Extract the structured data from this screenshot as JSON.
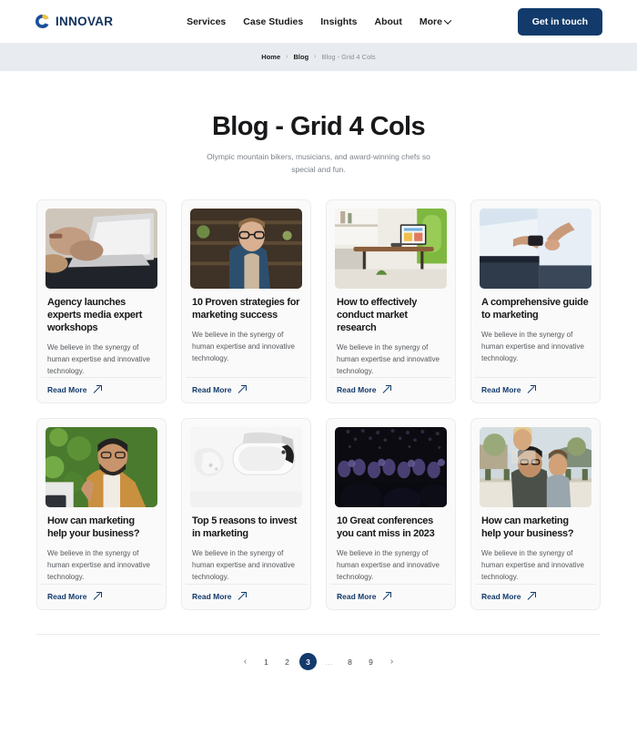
{
  "brand": {
    "name": "INNOVAR",
    "mark_icon": "innovar-swirl-logo",
    "colors": {
      "navy": "#123a6b",
      "yellow": "#f5c23c"
    }
  },
  "nav": {
    "items": [
      {
        "label": "Services",
        "has_chevron": false
      },
      {
        "label": "Case Studies",
        "has_chevron": false
      },
      {
        "label": "Insights",
        "has_chevron": false
      },
      {
        "label": "About",
        "has_chevron": false
      },
      {
        "label": "More",
        "has_chevron": true
      }
    ],
    "cta_label": "Get in touch"
  },
  "breadcrumb": {
    "separator": "›",
    "items": [
      {
        "label": "Home",
        "current": false
      },
      {
        "label": "Blog",
        "current": false
      },
      {
        "label": "Blog - Grid 4 Cols",
        "current": true
      }
    ]
  },
  "hero": {
    "title": "Blog - Grid 4 Cols",
    "subtitle": "Olympic mountain bikers, musicians, and award-winning chefs so special and fun."
  },
  "posts": [
    {
      "title": "Agency launches experts media expert workshops",
      "description": "We believe in the synergy of human expertise and innovative technology.",
      "read_more_label": "Read More",
      "image_alt": "hands-typing-on-laptop",
      "image_palette": [
        "#cfc6bb",
        "#b9aa9a",
        "#e2e0dd",
        "#7c7166"
      ]
    },
    {
      "title": "10 Proven strategies for marketing success",
      "description": "We believe in the synergy of human expertise and innovative technology.",
      "read_more_label": "Read More",
      "image_alt": "man-in-blue-blazer-with-glasses",
      "image_palette": [
        "#3f3226",
        "#2d4f6e",
        "#c8b39a",
        "#1d2a33"
      ]
    },
    {
      "title": "How to effectively conduct market research",
      "description": "We believe in the synergy of human expertise and innovative technology.",
      "read_more_label": "Read More",
      "image_alt": "tablet-on-wooden-desk-in-living-room",
      "image_palette": [
        "#efece6",
        "#8cc044",
        "#8a5f3a",
        "#d8d3ca"
      ]
    },
    {
      "title": "A comprehensive guide to marketing",
      "description": "We believe in the synergy of human expertise and innovative technology.",
      "read_more_label": "Read More",
      "image_alt": "handshake-exchanging-phone",
      "image_palette": [
        "#b8cde0",
        "#dfe9f2",
        "#2b3a4a",
        "#c99a7a"
      ]
    },
    {
      "title": "How can marketing help your business?",
      "description": "We believe in the synergy of human expertise and innovative technology.",
      "read_more_label": "Read More",
      "image_alt": "bearded-man-in-tan-jacket-outdoors",
      "image_palette": [
        "#4a7a2e",
        "#c9903f",
        "#2b2b2b",
        "#8fb85c"
      ]
    },
    {
      "title": "Top 5 reasons to invest in marketing",
      "description": "We believe in the synergy of human expertise and innovative technology.",
      "read_more_label": "Read More",
      "image_alt": "white-vr-headset",
      "image_palette": [
        "#f4f4f4",
        "#e2e2e2",
        "#cfcfcf",
        "#2a2a2a"
      ]
    },
    {
      "title": "10 Great conferences you cant miss in 2023",
      "description": "We believe in the synergy of human expertise and innovative technology.",
      "read_more_label": "Read More",
      "image_alt": "dark-conference-audience",
      "image_palette": [
        "#0c0c12",
        "#2a2340",
        "#4b3f6b",
        "#15131c"
      ]
    },
    {
      "title": "How can marketing help your business?",
      "description": "We believe in the synergy of human expertise and innovative technology.",
      "read_more_label": "Read More",
      "image_alt": "father-with-two-children-outdoors",
      "image_palette": [
        "#d9d2c4",
        "#6f8a4a",
        "#2f3b45",
        "#b9c6cf"
      ]
    }
  ],
  "pagination": {
    "prev_icon": "‹",
    "next_icon": "›",
    "items": [
      {
        "label": "1",
        "active": false,
        "ellipsis": false
      },
      {
        "label": "2",
        "active": false,
        "ellipsis": false
      },
      {
        "label": "3",
        "active": true,
        "ellipsis": false
      },
      {
        "label": "…",
        "active": false,
        "ellipsis": true
      },
      {
        "label": "8",
        "active": false,
        "ellipsis": false
      },
      {
        "label": "9",
        "active": false,
        "ellipsis": false
      }
    ]
  }
}
